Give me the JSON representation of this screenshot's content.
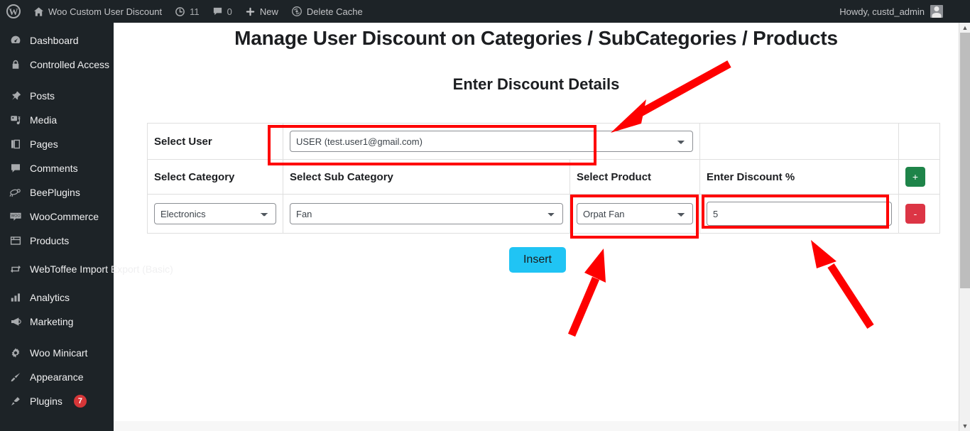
{
  "adminbar": {
    "logo_icon": "wordpress-logo-icon",
    "site_icon": "home-icon",
    "site_name": "Woo Custom User Discount",
    "updates_icon": "updates-icon",
    "updates_count": "11",
    "comments_icon": "comment-bubble-icon",
    "comments_count": "0",
    "new_icon": "plus-icon",
    "new_label": "New",
    "cache_icon": "delete-cache-icon",
    "cache_label": "Delete Cache",
    "howdy": "Howdy, custd_admin",
    "avatar_icon": "avatar-icon"
  },
  "sidebar": {
    "items": [
      {
        "label": "Dashboard",
        "icon": "dashboard-icon",
        "badge": ""
      },
      {
        "label": "Controlled Access",
        "icon": "lock-icon",
        "badge": ""
      },
      {
        "label": "Posts",
        "icon": "pin-icon",
        "badge": ""
      },
      {
        "label": "Media",
        "icon": "media-icon",
        "badge": ""
      },
      {
        "label": "Pages",
        "icon": "pages-icon",
        "badge": ""
      },
      {
        "label": "Comments",
        "icon": "comments-icon",
        "badge": ""
      },
      {
        "label": "BeePlugins",
        "icon": "bee-icon",
        "badge": ""
      },
      {
        "label": "WooCommerce",
        "icon": "woo-icon",
        "badge": ""
      },
      {
        "label": "Products",
        "icon": "products-icon",
        "badge": ""
      },
      {
        "label": "WebToffee Import Export (Basic)",
        "icon": "import-export-icon",
        "badge": ""
      },
      {
        "label": "Analytics",
        "icon": "analytics-icon",
        "badge": ""
      },
      {
        "label": "Marketing",
        "icon": "megaphone-icon",
        "badge": ""
      },
      {
        "label": "Woo Minicart",
        "icon": "gear-icon",
        "badge": ""
      },
      {
        "label": "Appearance",
        "icon": "brush-icon",
        "badge": ""
      },
      {
        "label": "Plugins",
        "icon": "plug-icon",
        "badge": "7"
      }
    ]
  },
  "main": {
    "page_title": "Manage User Discount on Categories / SubCategories / Products",
    "section_title": "Enter Discount Details",
    "user_row": {
      "label": "Select User",
      "select_value": "USER (test.user1@gmail.com)"
    },
    "headers": {
      "category": "Select Category",
      "subcategory": "Select Sub Category",
      "product": "Select Product",
      "discount": "Enter Discount %"
    },
    "row": {
      "category_value": "Electronics",
      "subcategory_value": "Fan",
      "product_value": "Orpat Fan",
      "discount_value": "5",
      "discount_placeholder": ""
    },
    "add_button_label": "+",
    "remove_button_label": "-",
    "insert_button_label": "Insert"
  },
  "annotations": {
    "highlight_color": "#fe0000",
    "arrow_color": "#fe0000",
    "boxes": [
      {
        "name": "select-user-highlight"
      },
      {
        "name": "select-product-highlight"
      },
      {
        "name": "enter-discount-highlight"
      }
    ],
    "arrows": [
      {
        "name": "arrow-to-select-user"
      },
      {
        "name": "arrow-to-select-product"
      },
      {
        "name": "arrow-to-enter-discount"
      }
    ]
  },
  "colors": {
    "adminbar_bg": "#1d2327",
    "sidebar_bg": "#1d2327",
    "insert_button_bg": "#20c4f4",
    "add_button_bg": "#1e8449",
    "remove_button_bg": "#dc3545",
    "badge_bg": "#d63638"
  }
}
